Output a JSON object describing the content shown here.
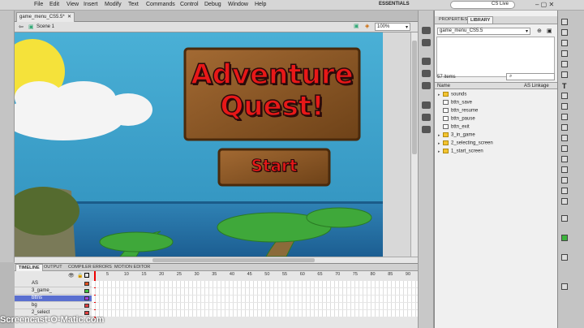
{
  "menubar": {
    "items": [
      "File",
      "Edit",
      "View",
      "Insert",
      "Modify",
      "Text",
      "Commands",
      "Control",
      "Debug",
      "Window",
      "Help"
    ],
    "workspace": "ESSENTIALS",
    "cs_live": "CS Live"
  },
  "document": {
    "tab": "game_menu_CS5.5*",
    "scene": "Scene 1",
    "zoom": "100%"
  },
  "stage": {
    "title_line1": "Adventure",
    "title_line2": "Quest!",
    "start_button": "Start"
  },
  "library": {
    "tabs": [
      "PROPERTIES",
      "LIBRARY"
    ],
    "doc_dropdown": "game_menu_CS5.5",
    "item_count": "57 items",
    "col_name": "Name",
    "col_linkage": "AS Linkage",
    "items": [
      {
        "name": "sounds",
        "kind": "folder"
      },
      {
        "name": "bttn_save",
        "kind": "button"
      },
      {
        "name": "bttn_resume",
        "kind": "button"
      },
      {
        "name": "bttn_pause",
        "kind": "button"
      },
      {
        "name": "bttn_exit",
        "kind": "button"
      },
      {
        "name": "3_in_game",
        "kind": "folder"
      },
      {
        "name": "2_selecting_screen",
        "kind": "folder"
      },
      {
        "name": "1_start_screen",
        "kind": "folder"
      }
    ]
  },
  "timeline": {
    "tabs": [
      "TIMELINE",
      "OUTPUT",
      "COMPILER ERRORS",
      "MOTION EDITOR"
    ],
    "ruler": [
      "5",
      "10",
      "15",
      "20",
      "25",
      "30",
      "35",
      "40",
      "45",
      "50",
      "55",
      "60",
      "65",
      "70",
      "75",
      "80",
      "85",
      "90"
    ],
    "layers": [
      {
        "name": "AS",
        "color": "#e05020"
      },
      {
        "name": "3_game_",
        "color": "#40c040"
      },
      {
        "name": "bttns",
        "color": "#a040e0"
      },
      {
        "name": "bg",
        "color": "#e04040"
      },
      {
        "name": "2_select",
        "color": "#e04040"
      }
    ]
  },
  "watermark": "Screencast-O-Matic.com",
  "colors": {
    "sky": "#3aa0c8",
    "sea": "#2a7fb0",
    "wood": "#8b5a2b",
    "title_red": "#e81818"
  }
}
